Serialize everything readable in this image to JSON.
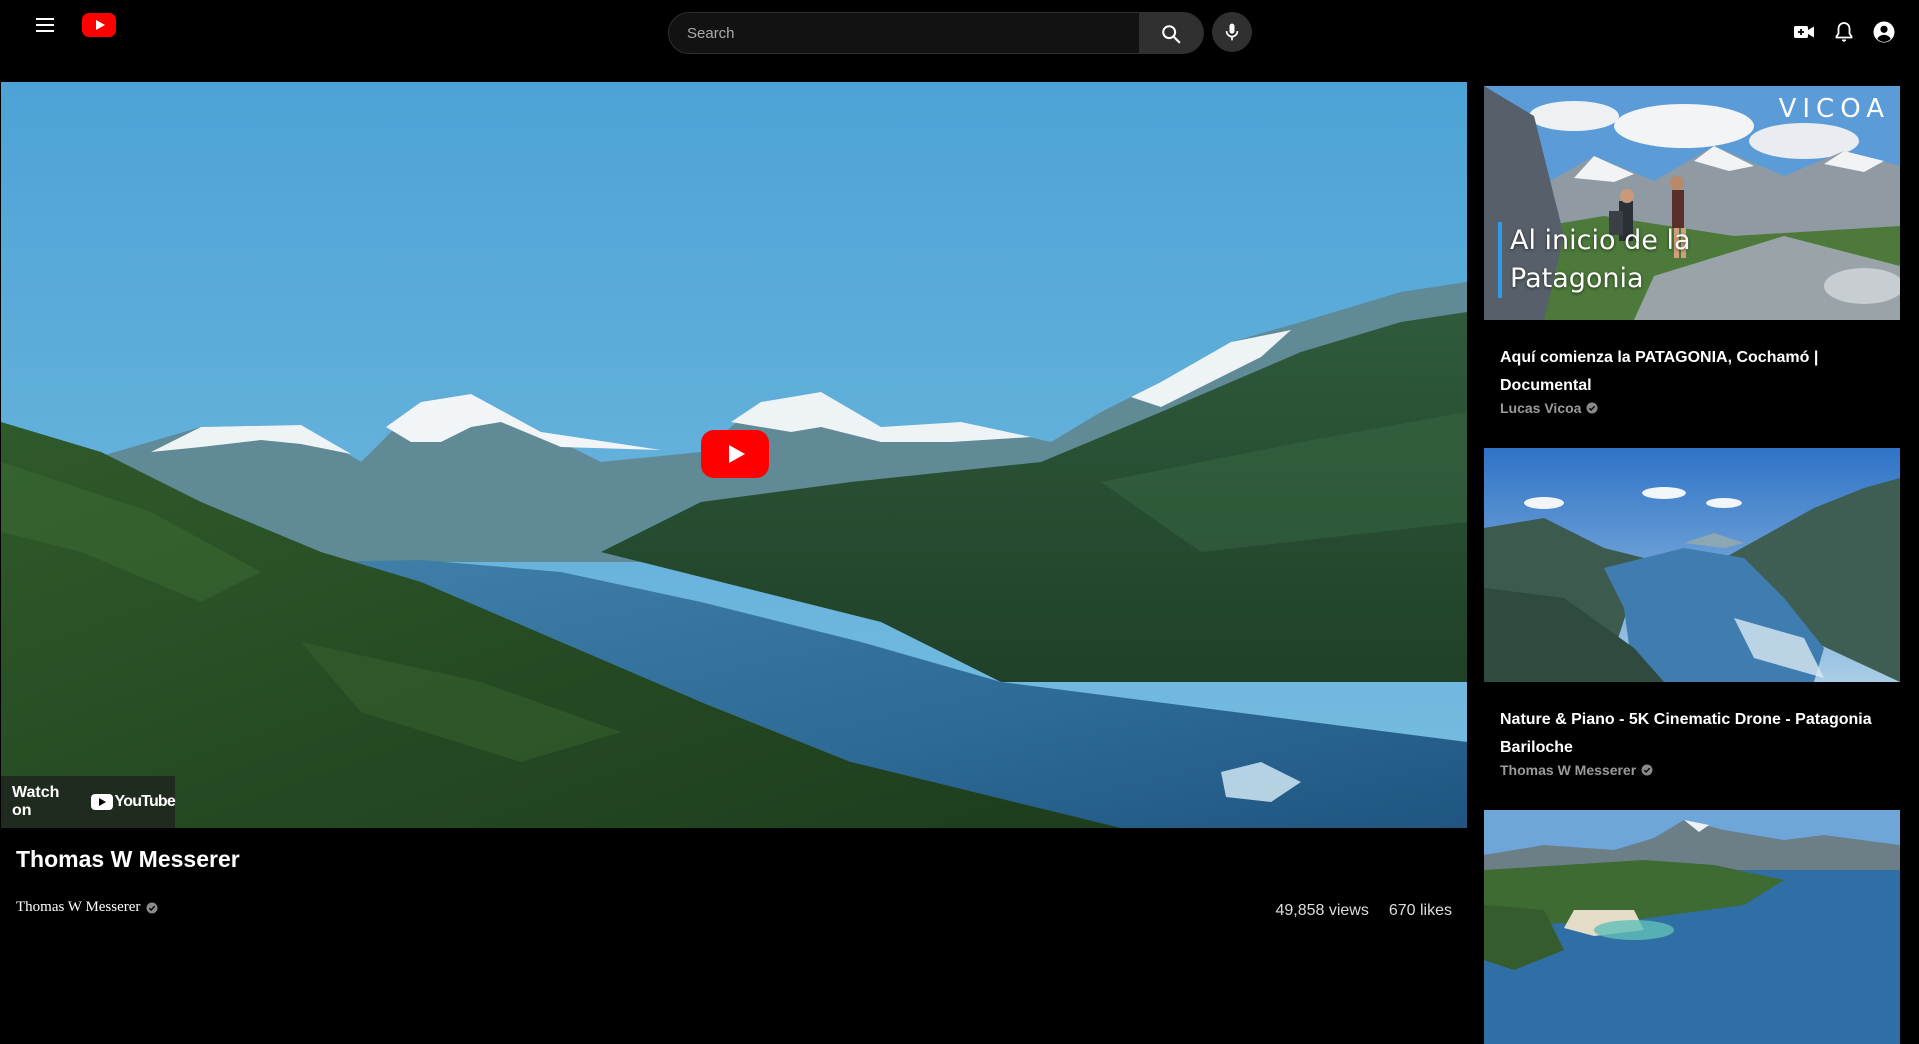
{
  "header": {
    "search_placeholder": "Search",
    "icons": [
      "menu-icon",
      "youtube-logo-icon",
      "search-icon",
      "microphone-icon",
      "create-video-icon",
      "notifications-bell-icon",
      "account-icon"
    ]
  },
  "player": {
    "watch_on_label": "Watch on",
    "youtube_wordmark": "YouTube"
  },
  "video": {
    "title": "Thomas W Messerer",
    "channel": "Thomas W Messerer",
    "views": "49,858 views",
    "likes": "670 likes"
  },
  "recommendations": [
    {
      "title": "Aquí comienza la PATAGONIA, Cochamó | Documental",
      "channel": "Lucas Vicoa",
      "thumb_brand": "VICOA",
      "thumb_caption": "Al inicio de la Patagonia"
    },
    {
      "title": "Nature & Piano - 5K Cinematic Drone - Patagonia Bariloche",
      "channel": "Thomas W Messerer"
    },
    {
      "title": "",
      "channel": ""
    }
  ],
  "colors": {
    "background": "#000000",
    "accent_red": "#ff0000",
    "secondary_text": "#9a9a9a"
  }
}
